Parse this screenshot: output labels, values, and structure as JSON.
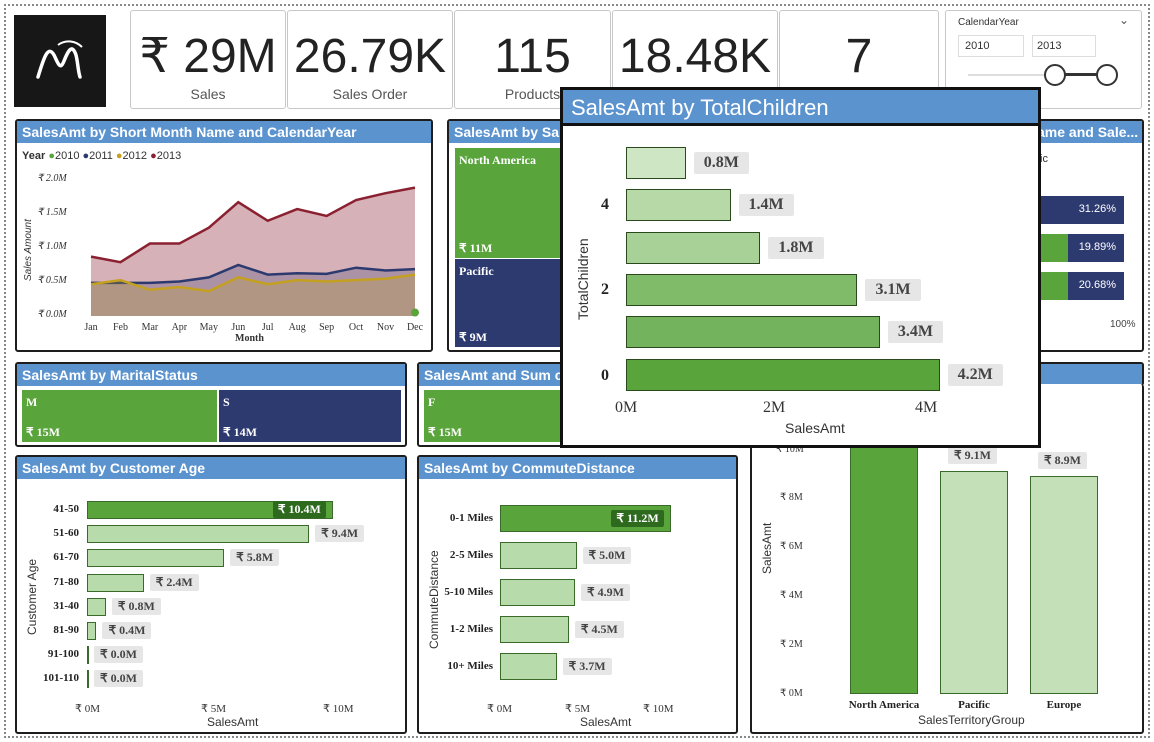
{
  "cards": [
    {
      "value": "₹ 29M",
      "label": "Sales"
    },
    {
      "value": "26.79K",
      "label": "Sales Order"
    },
    {
      "value": "115",
      "label": "Products"
    },
    {
      "value": "18.48K",
      "label": ""
    },
    {
      "value": "7",
      "label": ""
    }
  ],
  "slicer": {
    "title": "CalendarYear",
    "from": "2010",
    "to": "2013",
    "range": [
      2010,
      2013
    ]
  },
  "line": {
    "title": "SalesAmt by Short Month Name and CalendarYear",
    "legend_title": "Year",
    "ylabel": "Sales Amount",
    "xlabel": "Month",
    "yticks": [
      "₹ 2.0M",
      "₹ 1.5M",
      "₹ 1.0M",
      "₹ 0.5M",
      "₹ 0.0M"
    ],
    "chart_data": {
      "type": "area",
      "categories": [
        "Jan",
        "Feb",
        "Mar",
        "Apr",
        "May",
        "Jun",
        "Jul",
        "Aug",
        "Sep",
        "Oct",
        "Nov",
        "Dec"
      ],
      "ylim": [
        0,
        2.0
      ],
      "series": [
        {
          "name": "2010",
          "color": "#5aa43c",
          "values": [
            0,
            0,
            0,
            0,
            0,
            0,
            0,
            0,
            0,
            0,
            0,
            0.05
          ]
        },
        {
          "name": "2011",
          "color": "#2d3a6f",
          "values": [
            0.48,
            0.48,
            0.48,
            0.5,
            0.56,
            0.74,
            0.6,
            0.62,
            0.61,
            0.7,
            0.66,
            0.68
          ]
        },
        {
          "name": "2012",
          "color": "#c4a020",
          "values": [
            0.46,
            0.52,
            0.38,
            0.42,
            0.36,
            0.56,
            0.46,
            0.52,
            0.5,
            0.52,
            0.54,
            0.6
          ]
        },
        {
          "name": "2013",
          "color": "#8a2030",
          "values": [
            0.86,
            0.78,
            1.05,
            1.05,
            1.28,
            1.65,
            1.38,
            1.55,
            1.45,
            1.68,
            1.78,
            1.86
          ]
        }
      ]
    }
  },
  "region": {
    "title": "SalesAmt by Sa",
    "tiles": [
      {
        "name": "North America",
        "value": "₹ 11M"
      },
      {
        "name": "Pacific",
        "value": "₹ 9M"
      }
    ]
  },
  "right": {
    "title": "ame and Sale...",
    "label_top": "ic",
    "bars": [
      {
        "pct": "31.26%",
        "green": 0.0
      },
      {
        "pct": "19.89%",
        "green": 0.33
      },
      {
        "pct": "20.68%",
        "green": 0.33
      }
    ],
    "axis": "100%"
  },
  "marital": {
    "title": "SalesAmt by MaritalStatus",
    "tiles": [
      {
        "name": "M",
        "value": "₹ 15M"
      },
      {
        "name": "S",
        "value": "₹ 14M"
      }
    ]
  },
  "sumc": {
    "title": "SalesAmt and Sum c",
    "tile": {
      "name": "F",
      "value": "₹ 15M"
    }
  },
  "popup": {
    "title": "SalesAmt by TotalChildren",
    "xlabel": "SalesAmt",
    "ylabel": "TotalChildren",
    "ytick_labels": [
      "4",
      "2",
      "0"
    ],
    "xtick_labels": [
      "0M",
      "2M",
      "4M"
    ],
    "labels": [
      "0.8M",
      "1.4M",
      "1.8M",
      "3.1M",
      "3.4M",
      "4.2M"
    ],
    "chart_data": {
      "type": "bar",
      "orientation": "horizontal",
      "categories": [
        "5",
        "4",
        "3",
        "2",
        "1",
        "0"
      ],
      "values": [
        0.8,
        1.4,
        1.8,
        3.1,
        3.4,
        4.2
      ],
      "xlim": [
        0,
        4.5
      ]
    }
  },
  "age": {
    "title": "SalesAmt by Customer Age",
    "ylabel": "Customer Age",
    "xlabel": "SalesAmt",
    "xticks": [
      "₹ 0M",
      "₹ 5M",
      "₹ 10M"
    ],
    "labels": [
      "₹ 10.4M",
      "₹ 9.4M",
      "₹ 5.8M",
      "₹ 2.4M",
      "₹ 0.8M",
      "₹ 0.4M",
      "₹ 0.0M",
      "₹ 0.0M"
    ],
    "chart_data": {
      "type": "bar",
      "orientation": "horizontal",
      "categories": [
        "41-50",
        "51-60",
        "61-70",
        "71-80",
        "31-40",
        "81-90",
        "91-100",
        "101-110"
      ],
      "values": [
        10.4,
        9.4,
        5.8,
        2.4,
        0.8,
        0.4,
        0.0,
        0.0
      ],
      "xlim": [
        0,
        11
      ]
    }
  },
  "commute": {
    "title": "SalesAmt by CommuteDistance",
    "ylabel": "CommuteDistance",
    "xlabel": "SalesAmt",
    "xticks": [
      "₹ 0M",
      "₹ 5M",
      "₹ 10M"
    ],
    "labels": [
      "₹ 11.2M",
      "₹ 5.0M",
      "₹ 4.9M",
      "₹ 4.5M",
      "₹ 3.7M"
    ],
    "chart_data": {
      "type": "bar",
      "orientation": "horizontal",
      "categories": [
        "0-1 Miles",
        "2-5 Miles",
        "5-10 Miles",
        "1-2 Miles",
        "10+ Miles"
      ],
      "values": [
        11.2,
        5.0,
        4.9,
        4.5,
        3.7
      ],
      "xlim": [
        0,
        11.5
      ]
    }
  },
  "territory": {
    "ylabel": "SalesAmt",
    "xlabel": "SalesTerritoryGroup",
    "yticks": [
      "₹ 10M",
      "₹ 8M",
      "₹ 6M",
      "₹ 4M",
      "₹ 2M",
      "₹ 0M"
    ],
    "labels": [
      "₹ 9.1M",
      "₹ 8.9M"
    ],
    "chart_data": {
      "type": "bar",
      "categories": [
        "North America",
        "Pacific",
        "Europe"
      ],
      "values": [
        11.0,
        9.1,
        8.9
      ],
      "ylim": [
        0,
        10
      ]
    }
  }
}
